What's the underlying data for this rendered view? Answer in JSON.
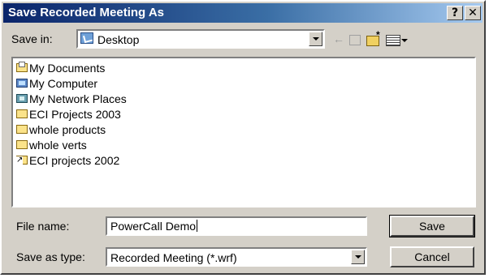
{
  "dialog": {
    "title": "Save Recorded Meeting As",
    "help_button": "?",
    "close_button": "✕"
  },
  "toolbar": {
    "save_in_label": "Save in:",
    "save_in_value": "Desktop",
    "back_icon": "←",
    "up_icon": "up-folder-icon",
    "new_folder_icon": "new-folder-icon",
    "views_icon": "views-menu-icon"
  },
  "file_list": {
    "items": [
      {
        "label": "My Documents",
        "icon": "my-documents-icon"
      },
      {
        "label": "My Computer",
        "icon": "computer-icon"
      },
      {
        "label": "My Network Places",
        "icon": "network-icon"
      },
      {
        "label": "ECI Projects 2003",
        "icon": "folder-icon"
      },
      {
        "label": "whole products",
        "icon": "folder-icon"
      },
      {
        "label": "whole verts",
        "icon": "folder-icon"
      },
      {
        "label": "ECI projects 2002",
        "icon": "shortcut-folder-icon"
      }
    ]
  },
  "form": {
    "file_name_label": "File name:",
    "file_name_value": "PowerCall Demo",
    "save_as_type_label": "Save as type:",
    "save_as_type_value": "Recorded Meeting  (*.wrf)"
  },
  "buttons": {
    "save": "Save",
    "cancel": "Cancel"
  }
}
